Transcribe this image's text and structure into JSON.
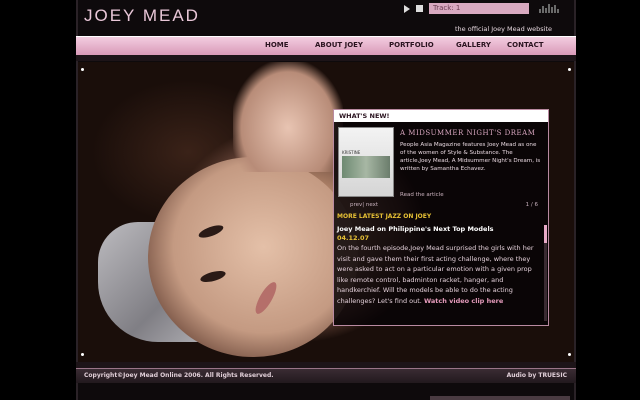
{
  "header": {
    "logo": "JOEY MEAD",
    "tagline": "the official Joey Mead website"
  },
  "player": {
    "track": "Track: 1",
    "play_icon": "play-icon",
    "stop_icon": "stop-icon"
  },
  "nav": {
    "items": [
      {
        "label": "HOME"
      },
      {
        "label": "ABOUT JOEY"
      },
      {
        "label": "PORTFOLIO"
      },
      {
        "label": "GALLERY"
      },
      {
        "label": "CONTACT"
      }
    ]
  },
  "whats_new": {
    "heading": "WHAT'S NEW!",
    "feature": {
      "thumb_text": "KRISTINE",
      "title": "A MIDSUMMER NIGHT'S DREAM",
      "body": "People Asia Magazine features Joey Mead as one of the women of Style & Substance. The article,Joey Mead, A Midsummer Night's Dream, is written by Samantha Echavez.",
      "link": "Read the article"
    },
    "pager": {
      "prev_next": "prev| next",
      "counter": "1 / 6"
    },
    "more_heading": "MORE LATEST JAZZ ON JOEY",
    "news": {
      "title": "Joey Mead on Philippine's Next Top Models",
      "date": "04.12.07",
      "body": "On the fourth episode,Joey Mead surprised the girls with her visit and gave them their first acting challenge, where they were asked to act on a particular emotion with a given prop like remote control, badminton racket, hanger, and handkerchief. Will the models be able to do the acting challenges? Let's find out.",
      "link": "Watch video clip here"
    }
  },
  "footer": {
    "copyright": "Copyright©Joey Mead Online 2006. All Rights Reserved.",
    "audio": "Audio by TRUESIC"
  }
}
